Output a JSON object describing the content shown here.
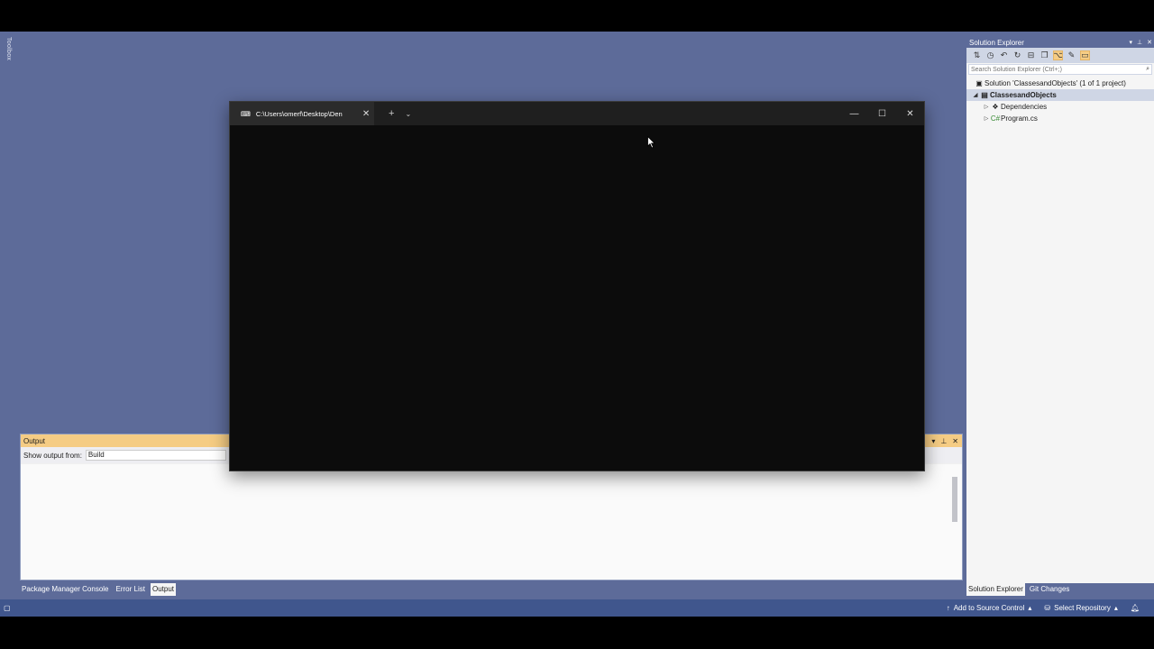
{
  "toolbox": {
    "label": "Toolbox"
  },
  "output": {
    "title": "Output",
    "show_from_label": "Show output from:",
    "source_value": "Build"
  },
  "bottom_tabs": [
    {
      "label": "Package Manager Console"
    },
    {
      "label": "Error List"
    },
    {
      "label": "Output"
    }
  ],
  "solution_explorer": {
    "title": "Solution Explorer",
    "search_placeholder": "Search Solution Explorer (Ctrl+;)",
    "solution": "Solution 'ClassesandObjects' (1 of 1 project)",
    "project": "ClassesandObjects",
    "items": [
      {
        "label": "Dependencies"
      },
      {
        "label": "Program.cs"
      }
    ],
    "tabs": [
      {
        "label": "Solution Explorer"
      },
      {
        "label": "Git Changes"
      }
    ]
  },
  "statusbar": {
    "add_to_source_control": "Add to Source Control",
    "select_repository": "Select Repository"
  },
  "terminal": {
    "tab_title": "C:\\Users\\omerf\\Desktop\\Den",
    "new_tab_icon": "plus-icon",
    "dropdown_icon": "chevron-down-icon"
  },
  "colors": {
    "ide_background": "#5d6b99",
    "statusbar": "#40568d",
    "output_header": "#f5cc84",
    "terminal_bg": "#0c0c0c"
  }
}
